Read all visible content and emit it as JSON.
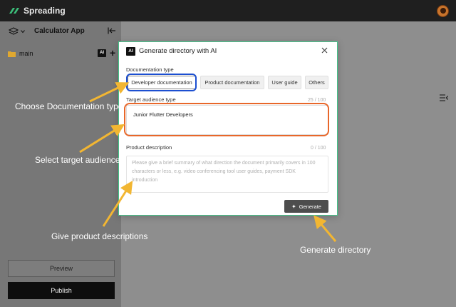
{
  "app": {
    "brand": "Spreading"
  },
  "sidebar": {
    "title": "Calculator App",
    "branch": "main",
    "ai_badge": "AI",
    "plus": "+",
    "preview_label": "Preview",
    "publish_label": "Publish"
  },
  "dialog": {
    "ai_badge": "AI",
    "title": "Generate directory with AI",
    "doc_type_label": "Documentation type",
    "doc_types": [
      {
        "label": "Developer documentation",
        "selected": true
      },
      {
        "label": "Product documentation",
        "selected": false
      },
      {
        "label": "User guide",
        "selected": false
      },
      {
        "label": "Others",
        "selected": false
      }
    ],
    "audience_label": "Target audience type",
    "audience_counter": "25 / 100",
    "audience_value": "Junior Flutter Developers",
    "description_label": "Product description",
    "description_counter": "0 / 100",
    "description_placeholder": "Please give a brief summary of what direction the document primarily covers in 100 characters or less, e.g. video conferencing tool user guides, payment SDK introduction",
    "generate_label": "Generate"
  },
  "annotations": {
    "doc_type": "Choose Documentation type",
    "audience": "Select target audience",
    "description": "Give product descriptions",
    "generate": "Generate directory"
  },
  "colors": {
    "arrow": "#f2b632",
    "highlight_blue": "#1c4fd1",
    "highlight_orange": "#e8672a",
    "dialog_border": "#44c58a",
    "brand_logo": "#3cbf7a"
  }
}
